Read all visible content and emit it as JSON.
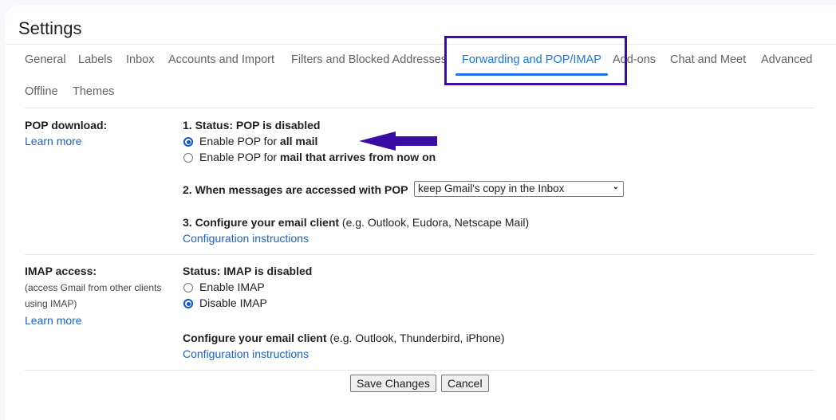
{
  "page": {
    "title": "Settings"
  },
  "tabs": [
    {
      "label": "General",
      "active": false
    },
    {
      "label": "Labels",
      "active": false
    },
    {
      "label": "Inbox",
      "active": false
    },
    {
      "label": "Accounts and Import",
      "active": false
    },
    {
      "label": "Filters and Blocked Addresses",
      "active": false
    },
    {
      "label": "Forwarding and POP/IMAP",
      "active": true
    },
    {
      "label": "Add-ons",
      "active": false
    },
    {
      "label": "Chat and Meet",
      "active": false
    },
    {
      "label": "Advanced",
      "active": false
    },
    {
      "label": "Offline",
      "active": false
    },
    {
      "label": "Themes",
      "active": false
    }
  ],
  "pop": {
    "label": "POP download:",
    "learn_more": "Learn more",
    "status": "1. Status: POP is disabled",
    "options": [
      {
        "prefix": "Enable POP for ",
        "bold": "all mail",
        "checked": true
      },
      {
        "prefix": "Enable POP for ",
        "bold": "mail that arrives from now on",
        "checked": false
      }
    ],
    "access_label": "2. When messages are accessed with POP",
    "access_select": "keep Gmail's copy in the Inbox",
    "configure_bold": "3. Configure your email client",
    "configure_note": " (e.g. Outlook, Eudora, Netscape Mail)",
    "config_link": "Configuration instructions"
  },
  "imap": {
    "label": "IMAP access:",
    "note_line1": "(access Gmail from other clients",
    "note_line2": "using IMAP)",
    "learn_more": "Learn more",
    "status": "Status: IMAP is disabled",
    "options": [
      {
        "label": "Enable IMAP",
        "checked": false
      },
      {
        "label": "Disable IMAP",
        "checked": true
      }
    ],
    "configure_bold": "Configure your email client",
    "configure_note": " (e.g. Outlook, Thunderbird, iPhone)",
    "config_link": "Configuration instructions"
  },
  "buttons": {
    "save": "Save Changes",
    "cancel": "Cancel"
  },
  "annotation": {
    "highlight_color": "#3a0ca3",
    "arrow_color": "#3a0ca3"
  }
}
